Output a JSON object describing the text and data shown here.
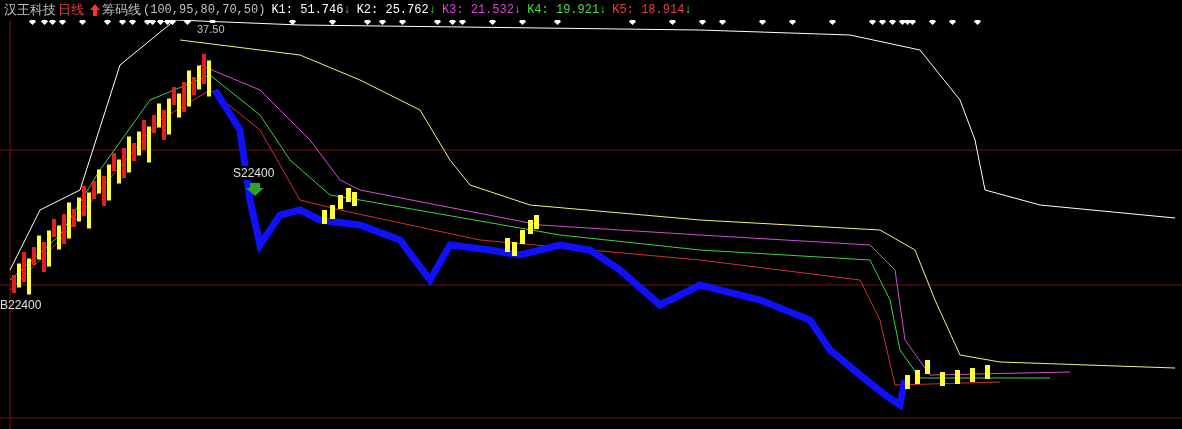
{
  "header": {
    "stock": "汉王科技",
    "period": "日线",
    "indicator": "筹码线",
    "params": "(100,95,80,70,50)"
  },
  "values": [
    {
      "label": "K1:",
      "value": "51.746",
      "arrow": "↓",
      "color": "#ffffff"
    },
    {
      "label": "K2:",
      "value": "25.762",
      "arrow": "↓",
      "color": "#ffffff"
    },
    {
      "label": "K3:",
      "value": "21.532",
      "arrow": "↓",
      "color": "#e040e0"
    },
    {
      "label": "K4:",
      "value": "19.921",
      "arrow": "↓",
      "color": "#40e040"
    },
    {
      "label": "K5:",
      "value": "18.914",
      "arrow": "↓",
      "color": "#e04040"
    }
  ],
  "chart": {
    "high_label": "37.50",
    "sell_label": "S22400",
    "buy_label": "B22400"
  }
}
